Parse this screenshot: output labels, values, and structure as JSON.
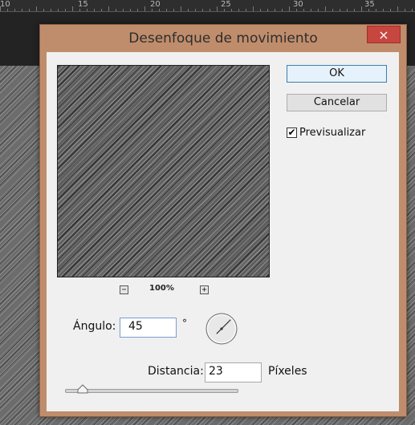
{
  "ruler": {
    "labels": [
      "10",
      "15",
      "20",
      "25",
      "30",
      "35"
    ]
  },
  "dialog": {
    "title": "Desenfoque de movimiento",
    "close_label": "×",
    "ok_label": "OK",
    "cancel_label": "Cancelar",
    "preview_label": "Previsualizar",
    "preview_checked": true,
    "zoom": {
      "minus_label": "−",
      "level": "100%",
      "plus_label": "+"
    },
    "angle": {
      "label": "Ángulo:",
      "value": "45",
      "unit": "°"
    },
    "distance": {
      "label": "Distancia:",
      "value": "23",
      "unit": "Píxeles",
      "slider_fraction": 0.1
    }
  },
  "colors": {
    "dialog_frame": "#c08d6c",
    "close_button": "#c7463f",
    "client_bg": "#f0f0f0",
    "workspace": "#232323"
  }
}
